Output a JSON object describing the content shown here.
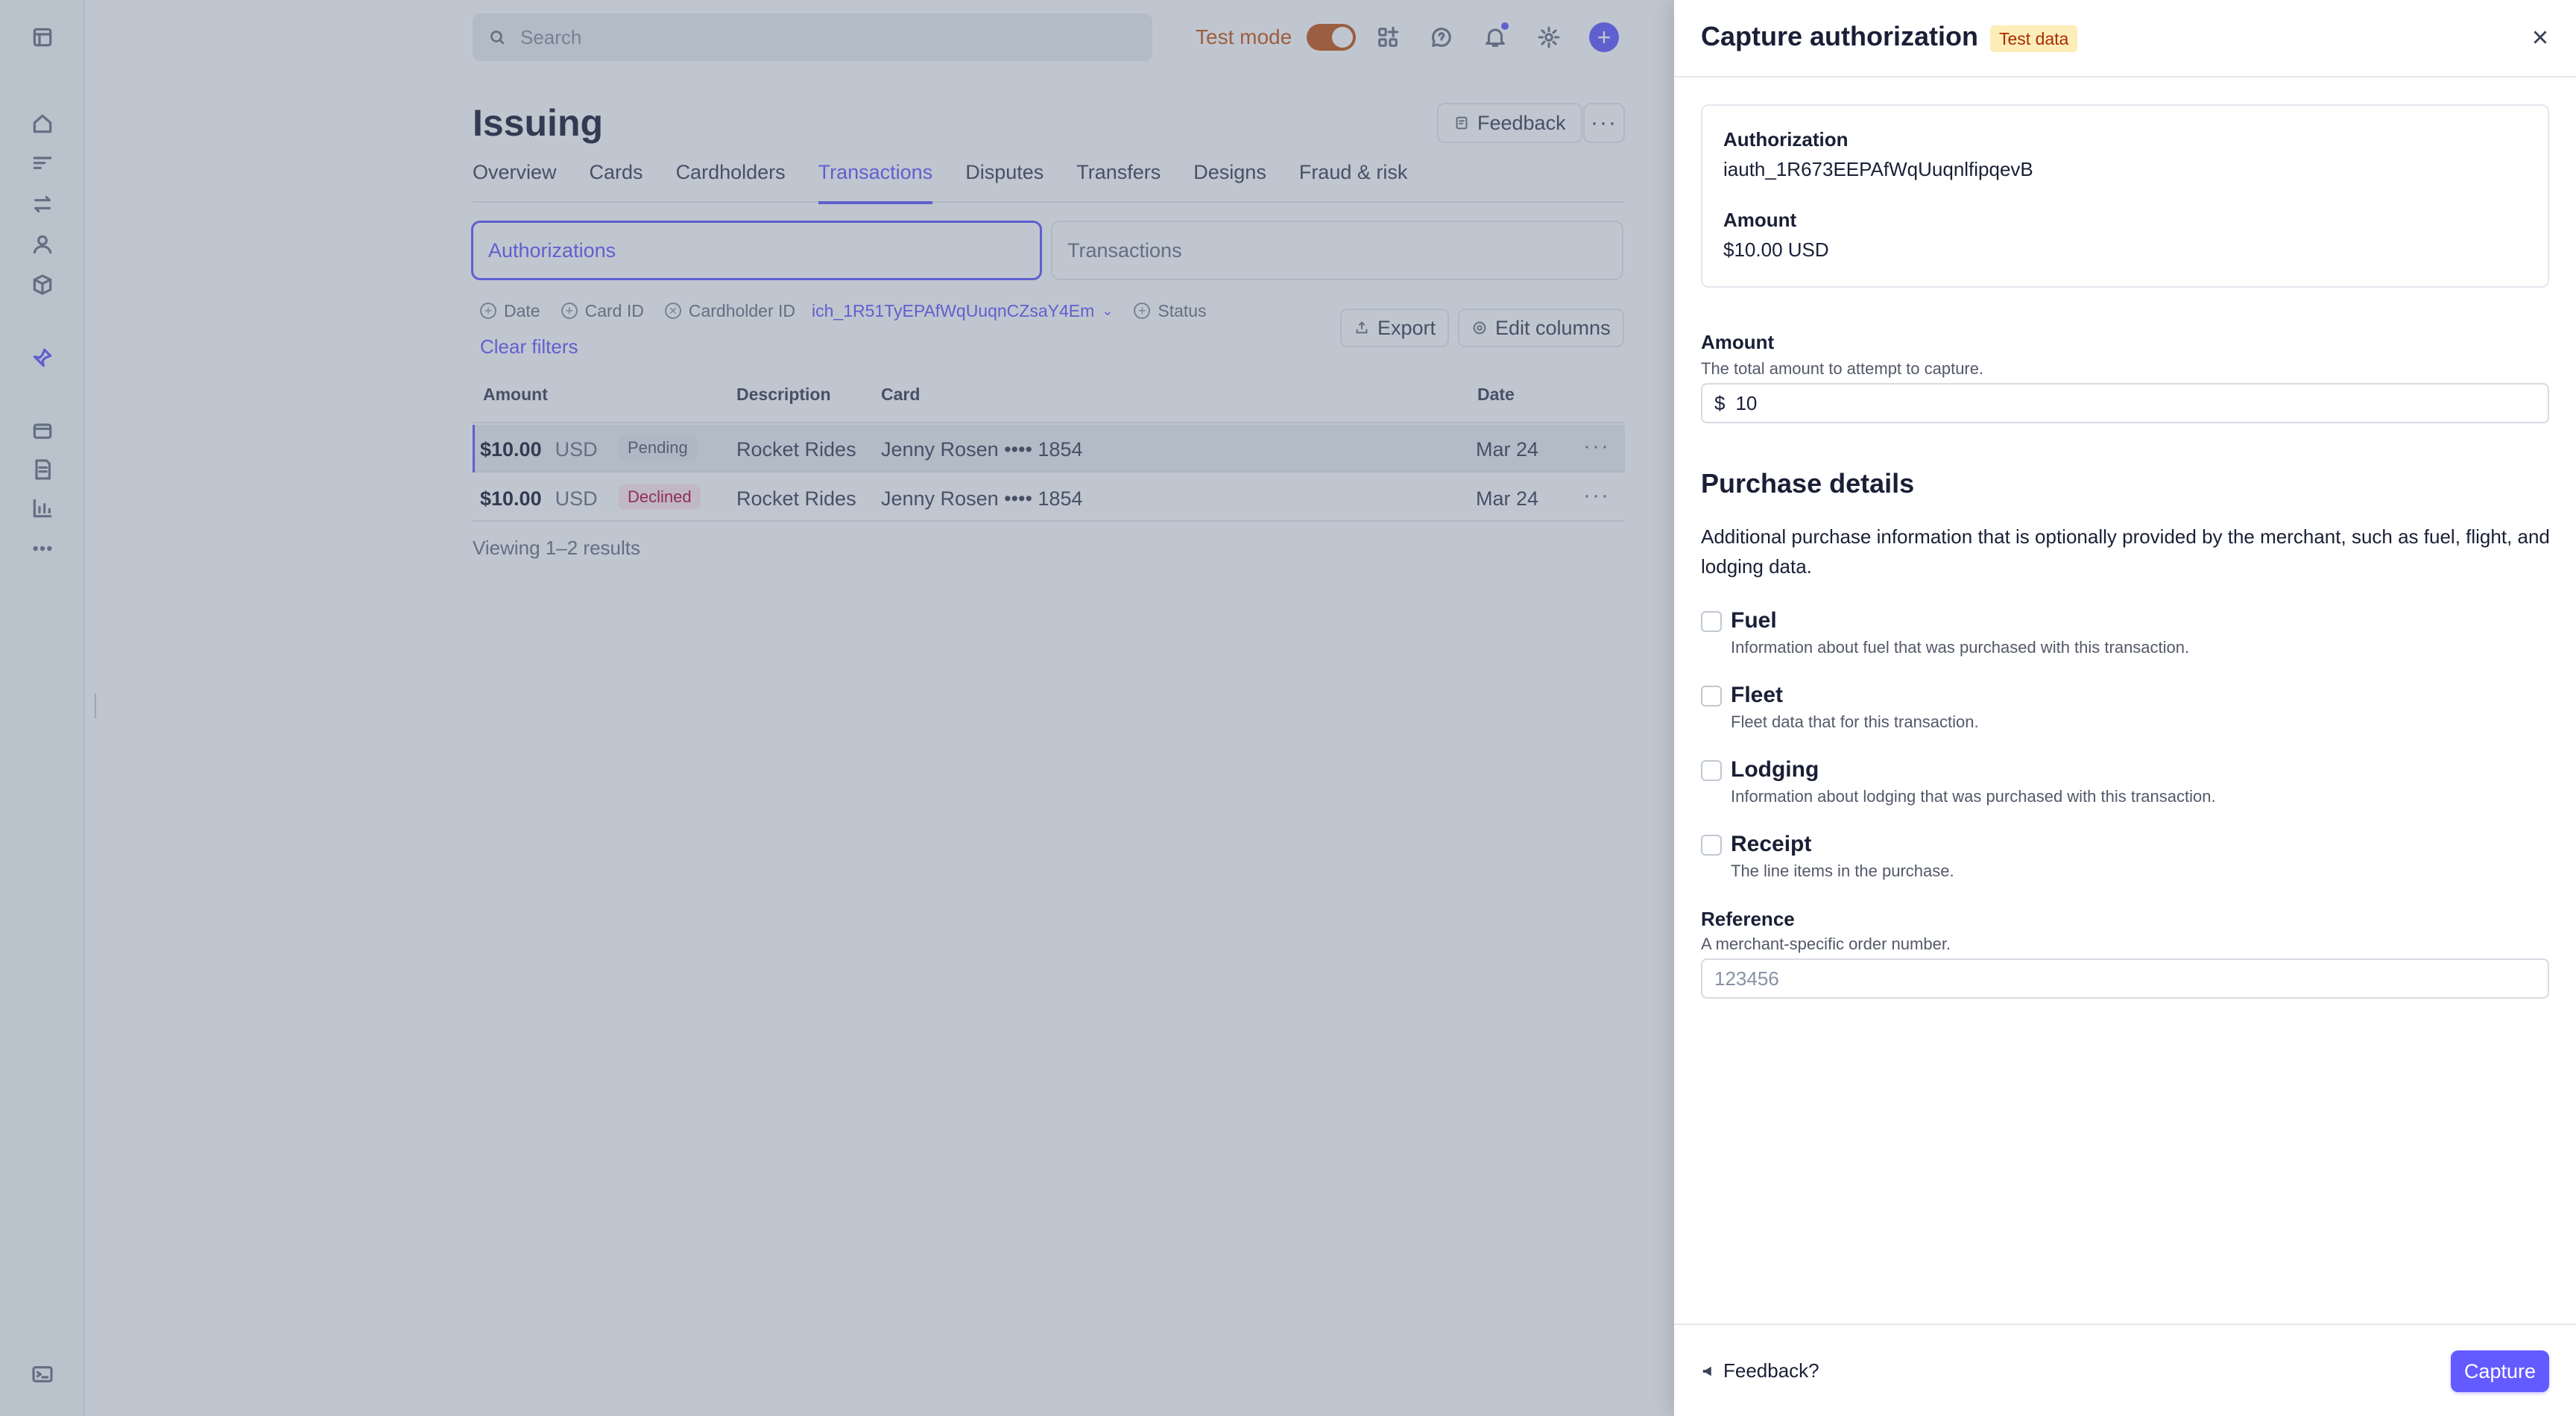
{
  "topbar": {
    "search_placeholder": "Search",
    "test_mode_label": "Test mode",
    "test_mode_on": true,
    "plus_label": "+"
  },
  "page": {
    "title": "Issuing",
    "feedback_label": "Feedback",
    "more_label": "···"
  },
  "tabs": [
    {
      "label": "Overview",
      "active": false
    },
    {
      "label": "Cards",
      "active": false
    },
    {
      "label": "Cardholders",
      "active": false
    },
    {
      "label": "Transactions",
      "active": true
    },
    {
      "label": "Disputes",
      "active": false
    },
    {
      "label": "Transfers",
      "active": false
    },
    {
      "label": "Designs",
      "active": false
    },
    {
      "label": "Fraud & risk",
      "active": false
    }
  ],
  "segments": {
    "authorizations": "Authorizations",
    "transactions": "Transactions"
  },
  "filters": {
    "date": "Date",
    "card_id": "Card ID",
    "cardholder_id": "Cardholder ID",
    "cardholder_value": "ich_1R51TyEPAfWqUuqnCZsaY4Em",
    "status": "Status",
    "clear": "Clear filters"
  },
  "actions": {
    "export": "Export",
    "edit_columns": "Edit columns"
  },
  "table": {
    "headers": {
      "amount": "Amount",
      "description": "Description",
      "card": "Card",
      "date": "Date"
    },
    "rows": [
      {
        "amount": "$10.00",
        "currency": "USD",
        "status": "Pending",
        "description": "Rocket Rides",
        "card": "Jenny Rosen •••• 1854",
        "date": "Mar 24"
      },
      {
        "amount": "$10.00",
        "currency": "USD",
        "status": "Declined",
        "description": "Rocket Rides",
        "card": "Jenny Rosen •••• 1854",
        "date": "Mar 24"
      }
    ],
    "row_more": "···",
    "viewing": "Viewing 1–2 results"
  },
  "drawer": {
    "title": "Capture authorization",
    "badge": "Test data",
    "authorization_label": "Authorization",
    "authorization_value": "iauth_1R673EEPAfWqUuqnlfipqevB",
    "amount_label": "Amount",
    "amount_value": "$10.00 USD",
    "amount_field_label": "Amount",
    "amount_field_help": "The total amount to attempt to capture.",
    "amount_field_prefix": "$",
    "amount_field_value": "10",
    "purchase_title": "Purchase details",
    "purchase_desc": "Additional purchase information that is optionally provided by the merchant, such as fuel, flight, and lodging data.",
    "options": [
      {
        "title": "Fuel",
        "desc": "Information about fuel that was purchased with this transaction."
      },
      {
        "title": "Fleet",
        "desc": "Fleet data that for this transaction."
      },
      {
        "title": "Lodging",
        "desc": "Information about lodging that was purchased with this transaction."
      },
      {
        "title": "Receipt",
        "desc": "The line items in the purchase."
      }
    ],
    "reference_label": "Reference",
    "reference_help": "A merchant-specific order number.",
    "reference_placeholder": "123456",
    "footer_feedback": "Feedback?",
    "capture_label": "Capture"
  },
  "colors": {
    "accent": "#635bff",
    "test_mode": "#c4581a",
    "test_badge_bg": "#fcedb9",
    "declined": "#b3093c"
  }
}
